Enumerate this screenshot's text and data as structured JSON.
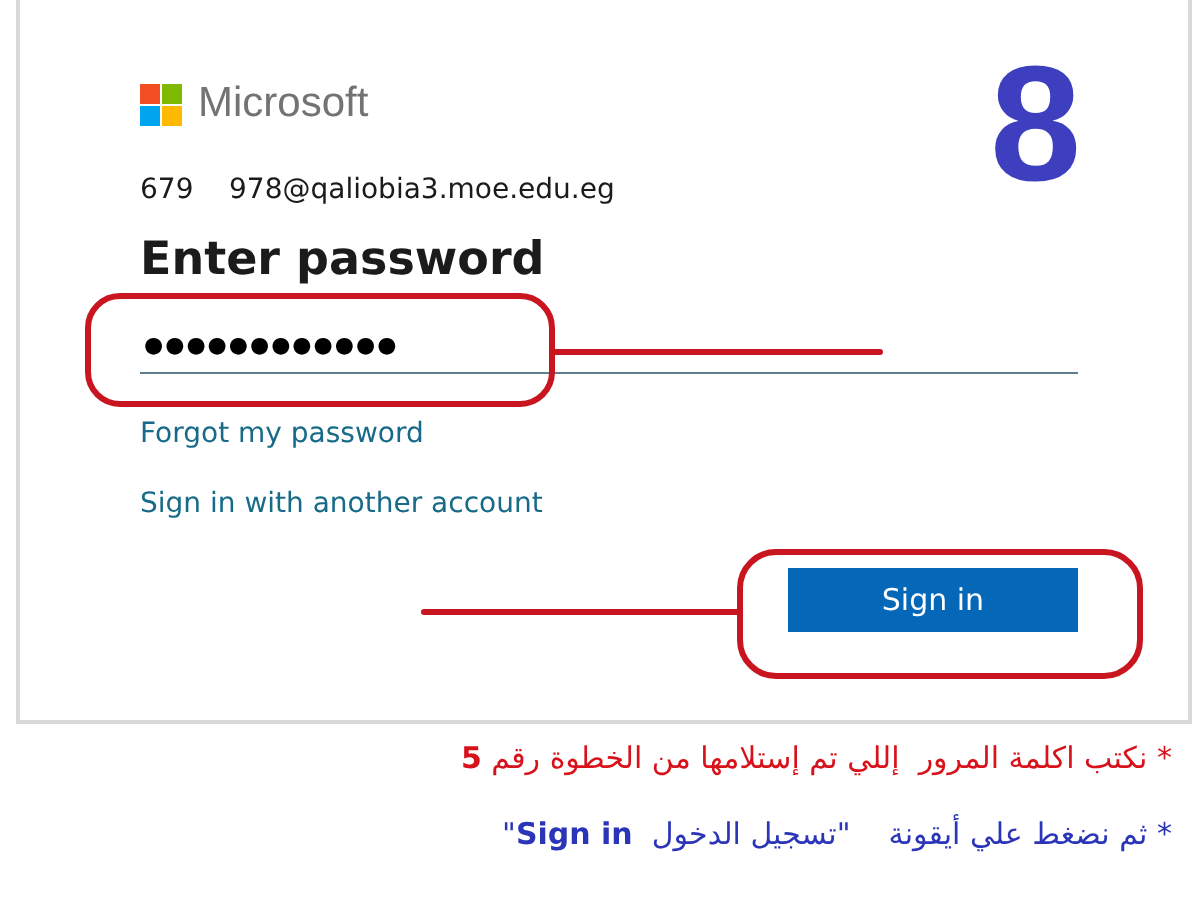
{
  "step_number": "8",
  "login": {
    "brand": "Microsoft",
    "account": "679    978@qaliobia3.moe.edu.eg",
    "title": "Enter password",
    "password": "●●●●●●●●●●●●",
    "links": [
      "Forgot my password",
      "Sign in with another account"
    ],
    "button": "Sign in"
  },
  "instructions": [
    {
      "text": "* نكتب اكلمة المرور  إللي تم إستلامها من الخطوة رقم **5**",
      "color": "#d8121b"
    },
    {
      "text": "* ثم نضغط علي أيقونة    \"تسجيل الدخول  **Sign in**\"",
      "color": "#2b35b8"
    }
  ]
}
